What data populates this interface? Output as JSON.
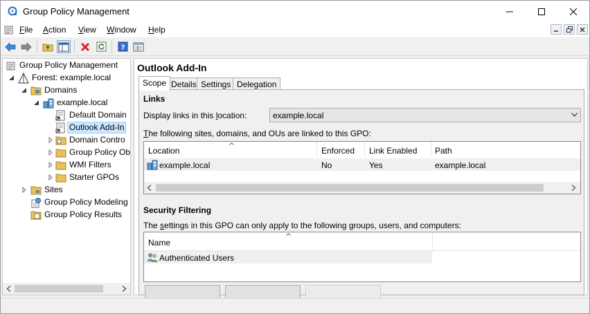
{
  "window": {
    "title": "Group Policy Management"
  },
  "menu": {
    "items": [
      {
        "mnemonic": "F",
        "rest": "ile"
      },
      {
        "mnemonic": "A",
        "rest": "ction"
      },
      {
        "mnemonic": "V",
        "rest": "iew"
      },
      {
        "mnemonic": "W",
        "rest": "indow"
      },
      {
        "mnemonic": "H",
        "rest": "elp"
      }
    ]
  },
  "toolbar": {
    "icons": [
      "back-icon",
      "forward-icon",
      "up-folder-icon",
      "show-hide-tree-icon",
      "delete-icon",
      "refresh-icon",
      "help-icon",
      "properties-icon"
    ]
  },
  "tree": {
    "items": [
      {
        "label": "Group Policy Management",
        "level": 0,
        "icon": "gpm-icon"
      },
      {
        "label": "Forest: example.local",
        "level": 1,
        "icon": "forest-icon"
      },
      {
        "label": "Domains",
        "level": 2,
        "icon": "folder-icon"
      },
      {
        "label": "example.local",
        "level": 3,
        "icon": "domain-icon"
      },
      {
        "label": "Default Domain",
        "level": 4,
        "icon": "gpo-link-icon"
      },
      {
        "label": "Outlook Add-In",
        "level": 4,
        "icon": "gpo-link-icon",
        "selected": true
      },
      {
        "label": "Domain Contro",
        "level": 4,
        "icon": "ou-folder-icon"
      },
      {
        "label": "Group Policy Ob",
        "level": 4,
        "icon": "folder-icon"
      },
      {
        "label": "WMI Filters",
        "level": 4,
        "icon": "folder-icon"
      },
      {
        "label": "Starter GPOs",
        "level": 4,
        "icon": "folder-icon"
      },
      {
        "label": "Sites",
        "level": 2,
        "icon": "folder-icon"
      },
      {
        "label": "Group Policy Modeling",
        "level": 2,
        "icon": "modeling-icon"
      },
      {
        "label": "Group Policy Results",
        "level": 2,
        "icon": "results-icon"
      }
    ]
  },
  "gpo": {
    "title": "Outlook Add-In",
    "tabs": [
      "Scope",
      "Details",
      "Settings",
      "Delegation"
    ],
    "active_tab": "Scope"
  },
  "links": {
    "heading": "Links",
    "display_label_pre": "Display links in this ",
    "display_label_mnemonic": "l",
    "display_label_post": "ocation:",
    "location_value": "example.local",
    "desc_mnemonic": "T",
    "desc_rest": "he following sites, domains, and OUs are linked to this GPO:",
    "columns": [
      "Location",
      "Enforced",
      "Link Enabled",
      "Path"
    ],
    "rows": [
      {
        "location": "example.local",
        "enforced": "No",
        "link_enabled": "Yes",
        "path": "example.local"
      }
    ]
  },
  "security": {
    "heading": "Security Filtering",
    "desc_pre": "The ",
    "desc_mnemonic": "s",
    "desc_post": "ettings in this GPO can only apply to the following groups, users, and computers:",
    "column": "Name",
    "rows": [
      {
        "name": "Authenticated Users"
      }
    ]
  }
}
